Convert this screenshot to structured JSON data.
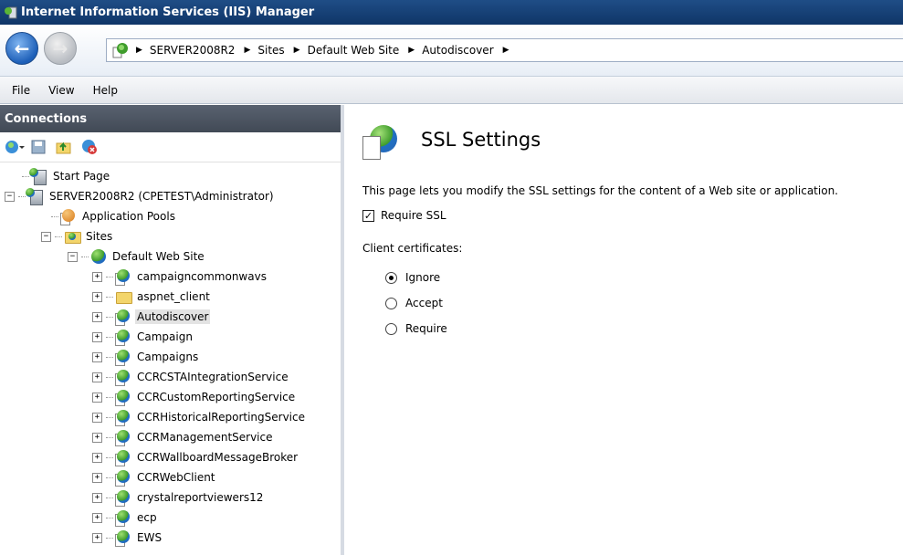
{
  "window": {
    "title": "Internet Information Services (IIS) Manager"
  },
  "address": {
    "crumbs": [
      "SERVER2008R2",
      "Sites",
      "Default Web Site",
      "Autodiscover"
    ]
  },
  "menu": {
    "items": [
      "File",
      "View",
      "Help"
    ]
  },
  "connections": {
    "title": "Connections",
    "tree": [
      {
        "label": "Start Page",
        "icon": "start-page-icon",
        "level": 0
      },
      {
        "label": "SERVER2008R2 (CPETEST\\Administrator)",
        "icon": "server-icon",
        "level": 0,
        "expanded": true
      },
      {
        "label": "Application Pools",
        "icon": "app-pool-icon",
        "level": 1
      },
      {
        "label": "Sites",
        "icon": "sites-folder-icon",
        "level": 1,
        "expanded": true
      },
      {
        "label": "Default Web Site",
        "icon": "web-site-icon",
        "level": 2,
        "expanded": true
      },
      {
        "label": "campaigncommonwavs",
        "icon": "web-app-icon",
        "level": 3
      },
      {
        "label": "aspnet_client",
        "icon": "folder-icon",
        "level": 3
      },
      {
        "label": "Autodiscover",
        "icon": "web-app-icon",
        "level": 3,
        "selected": true
      },
      {
        "label": "Campaign",
        "icon": "web-app-icon",
        "level": 3
      },
      {
        "label": "Campaigns",
        "icon": "web-app-icon",
        "level": 3
      },
      {
        "label": "CCRCSTAIntegrationService",
        "icon": "web-app-icon",
        "level": 3
      },
      {
        "label": "CCRCustomReportingService",
        "icon": "web-app-icon",
        "level": 3
      },
      {
        "label": "CCRHistoricalReportingService",
        "icon": "web-app-icon",
        "level": 3
      },
      {
        "label": "CCRManagementService",
        "icon": "web-app-icon",
        "level": 3
      },
      {
        "label": "CCRWallboardMessageBroker",
        "icon": "web-app-icon",
        "level": 3
      },
      {
        "label": "CCRWebClient",
        "icon": "web-app-icon",
        "level": 3
      },
      {
        "label": "crystalreportviewers12",
        "icon": "web-app-icon",
        "level": 3
      },
      {
        "label": "ecp",
        "icon": "web-app-icon",
        "level": 3
      },
      {
        "label": "EWS",
        "icon": "web-app-icon",
        "level": 3
      }
    ]
  },
  "ssl": {
    "title": "SSL Settings",
    "description": "This page lets you modify the SSL settings for the content of a Web site or application.",
    "require_ssl_label": "Require SSL",
    "require_ssl_checked": true,
    "client_certificates_label": "Client certificates:",
    "options": [
      {
        "label": "Ignore",
        "selected": true
      },
      {
        "label": "Accept",
        "selected": false
      },
      {
        "label": "Require",
        "selected": false
      }
    ]
  },
  "colors": {
    "title_bar": "#1f4d86",
    "connections_header": "#4f5866",
    "selected_row": "#e3e3e3"
  }
}
